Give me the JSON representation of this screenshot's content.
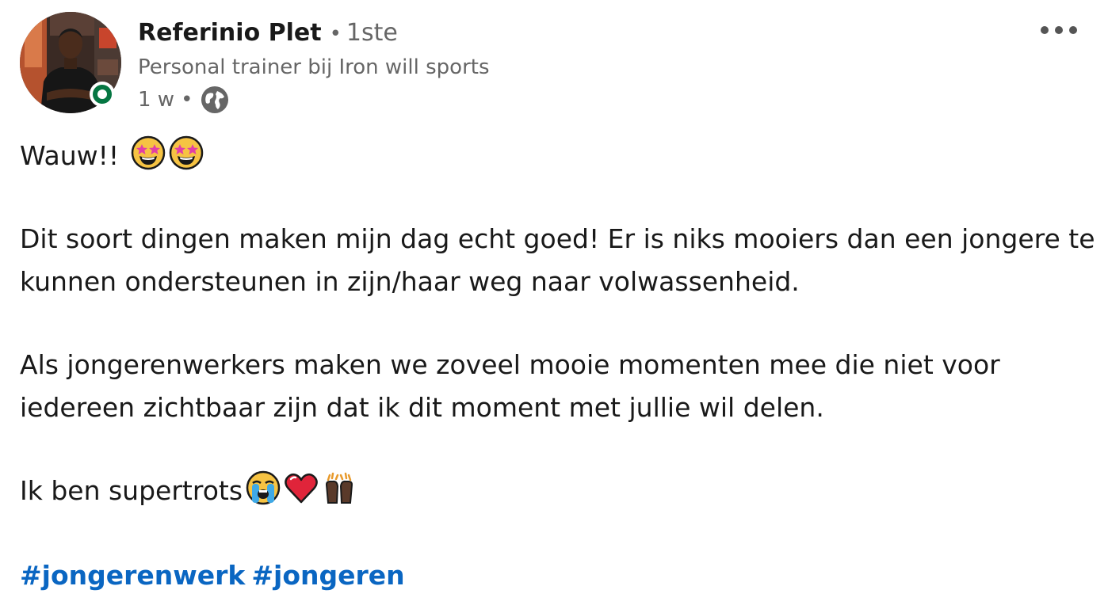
{
  "author": {
    "name": "Referinio Plet",
    "degree": "1ste",
    "headline": "Personal trainer bij Iron will sports",
    "time": "1 w",
    "visibility_icon": "globe-icon",
    "online_status": "online",
    "status_color": "#057642"
  },
  "post": {
    "line1": "Wauw!!",
    "line1_emojis": [
      "star-struck-icon",
      "star-struck-icon"
    ],
    "paragraph2": "Dit soort dingen maken mijn dag echt goed! Er is niks mooiers dan een jongere te kunnen ondersteunen in zijn/haar weg naar volwassenheid.",
    "paragraph3": "Als jongerenwerkers maken we zoveel mooie momenten mee die niet voor iedereen zichtbaar zijn dat ik dit moment met jullie wil delen.",
    "paragraph4": "Ik ben supertrots",
    "paragraph4_emojis": [
      "loudly-crying-face-icon",
      "red-heart-icon",
      "raising-hands-icon"
    ],
    "hashtags": [
      "#jongerenwerk",
      "#jongeren"
    ]
  },
  "colors": {
    "text": "#191919",
    "secondary_text": "#666666",
    "hashtag": "#0a66c2"
  },
  "menu_icon": "more-horizontal-icon"
}
